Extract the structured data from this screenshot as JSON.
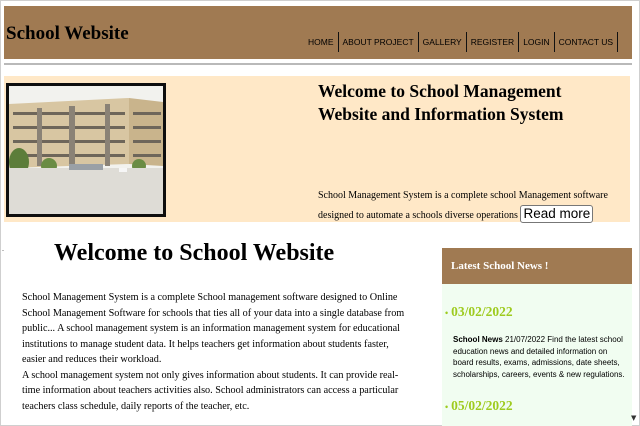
{
  "header": {
    "brand": "School Website",
    "nav": [
      {
        "label": "HOME"
      },
      {
        "label": "ABOUT PROJECT"
      },
      {
        "label": "GALLERY"
      },
      {
        "label": "REGISTER"
      },
      {
        "label": "LOGIN"
      },
      {
        "label": "CONTACT US"
      }
    ]
  },
  "hero": {
    "title": "Welcome to School Management Website and Information System",
    "description": "School Management System is a complete school Management software designed to automate a schools diverse operations",
    "read_more": "Read more"
  },
  "main": {
    "title": "Welcome to School Website",
    "paragraph1": "School Management System is a complete School management software designed to Online School Management Software for schools that ties all of your data into a single database from public... A school management system is an information management system for educational institutions to manage student data. It helps teachers get information about students faster, easier and reduces their workload.",
    "paragraph2": "A school management system not only gives information about students. It can provide real-time information about teachers activities also. School administrators can access a particular teachers class schedule, daily reports of the teacher, etc."
  },
  "sidebar": {
    "header": "Latest School News !",
    "items": [
      {
        "date": "03/02/2022",
        "title": "School News",
        "text": "21/07/2022 Find the latest school education news and detailed information on board results, exams, admissions, date sheets, scholarships, careers, events & new regulations."
      },
      {
        "date": "05/02/2022"
      }
    ]
  },
  "colors": {
    "header_bg": "#a07a52",
    "hero_bg": "#ffe8c7",
    "news_bg": "#f1fdf1",
    "news_date": "#9ecb1f"
  }
}
